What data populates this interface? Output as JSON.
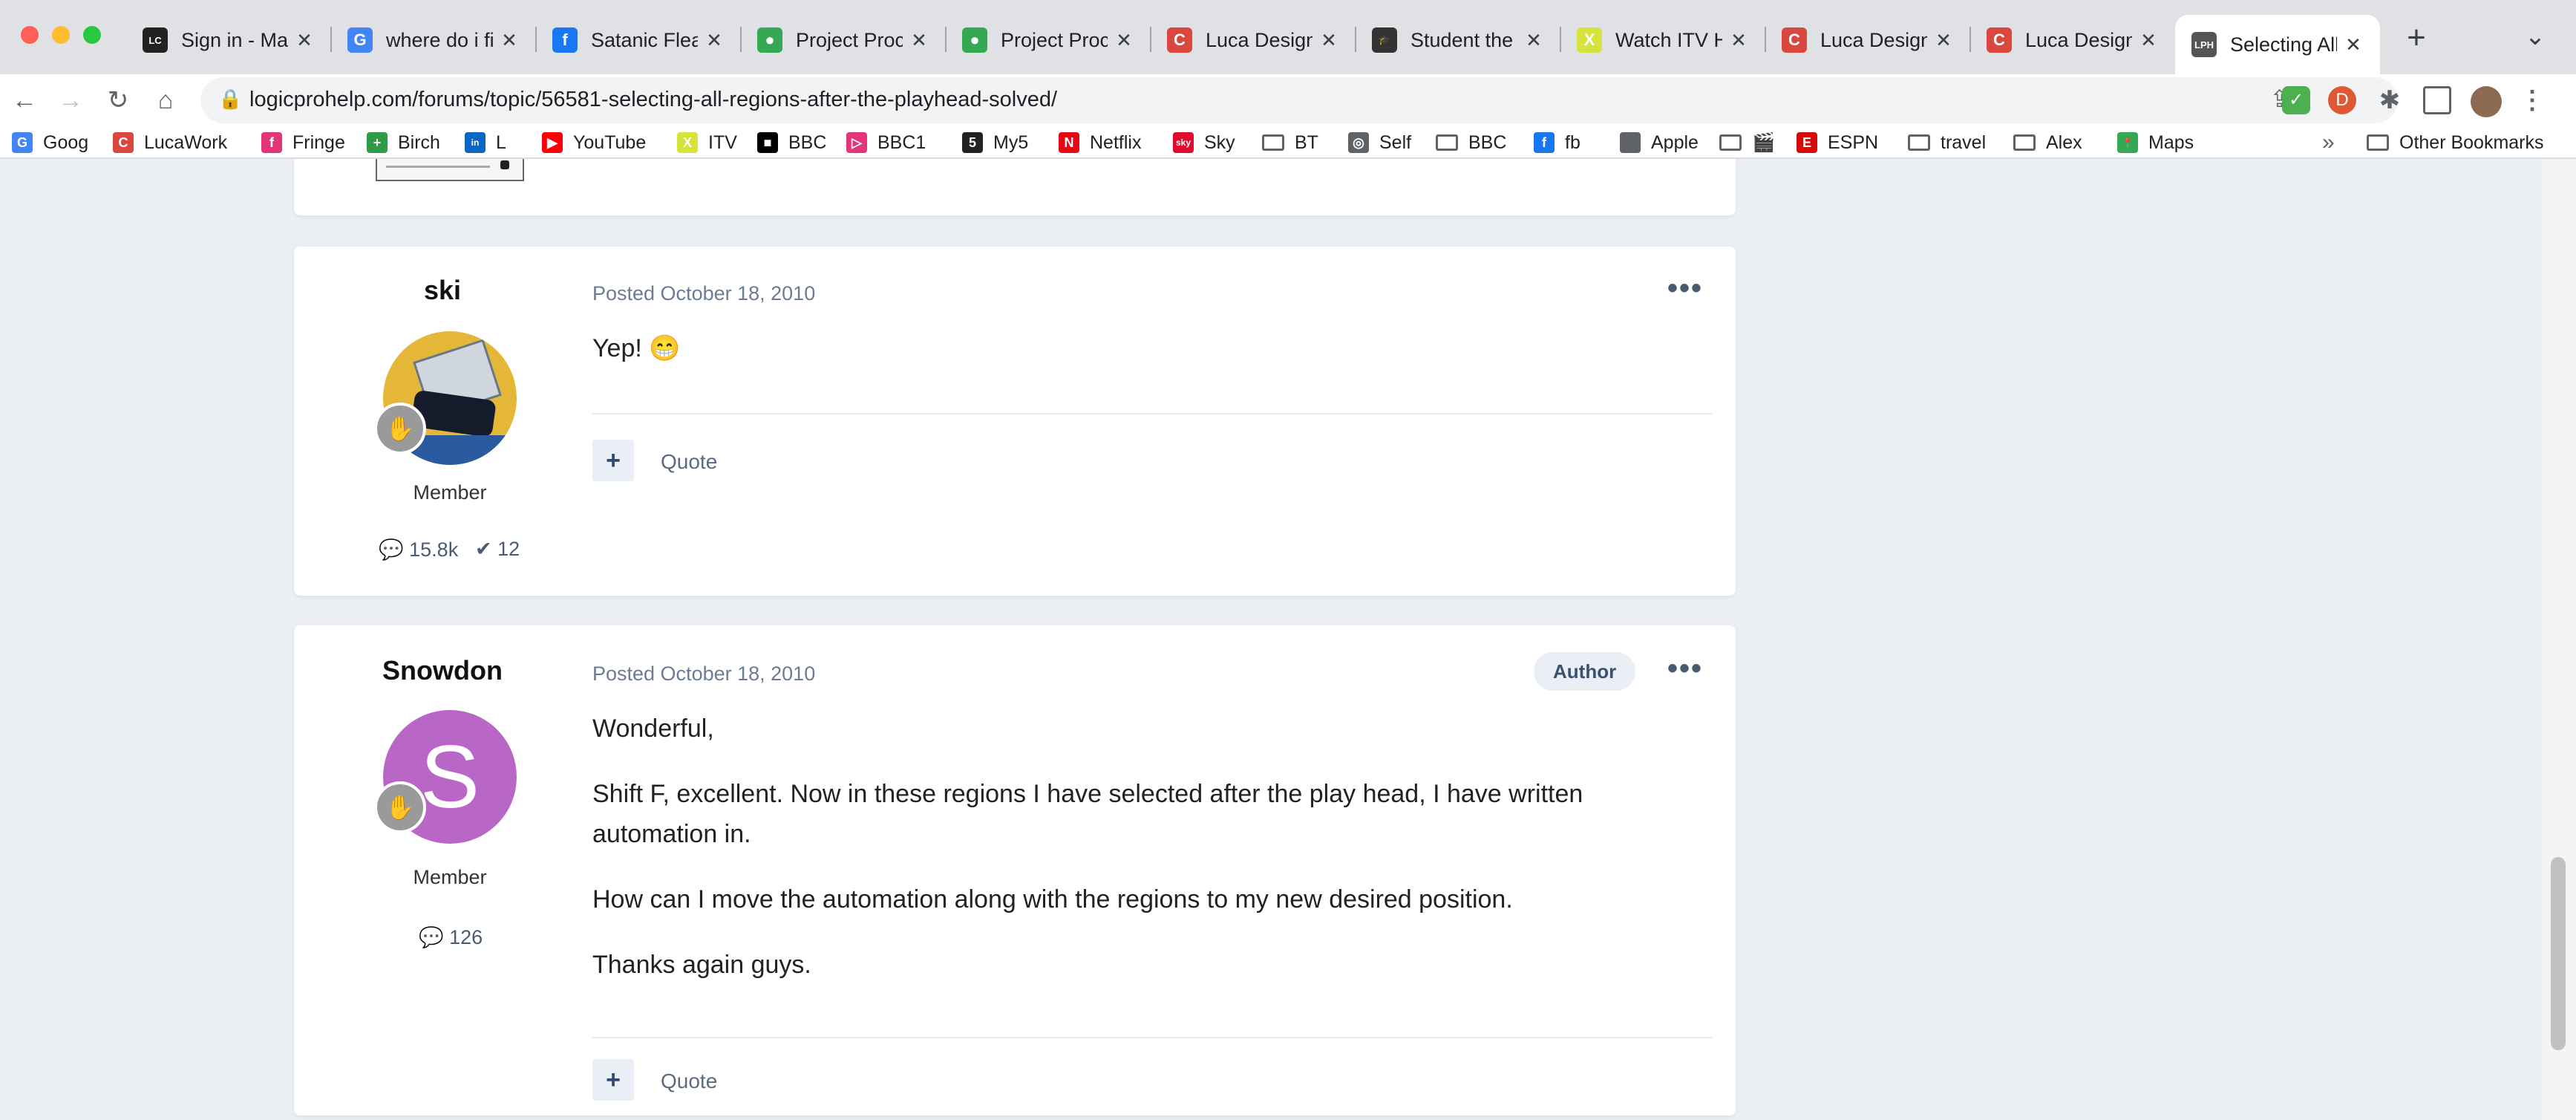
{
  "browser": {
    "tabs": [
      {
        "title": "Sign in - Mak",
        "fav": "LC",
        "favColor": "#222222"
      },
      {
        "title": "where do i fir",
        "fav": "G",
        "favColor": "#4285f4"
      },
      {
        "title": "Satanic Flea",
        "fav": "f",
        "favColor": "#1877f2"
      },
      {
        "title": "Project Proce",
        "fav": "●",
        "favColor": "#34a853"
      },
      {
        "title": "Project Proce",
        "fav": "●",
        "favColor": "#34a853"
      },
      {
        "title": "Luca Design",
        "fav": "C",
        "favColor": "#d9473f"
      },
      {
        "title": "Student the",
        "fav": "🎓",
        "favColor": "#333333"
      },
      {
        "title": "Watch ITV Hi",
        "fav": "X",
        "favColor": "#d7e23a"
      },
      {
        "title": "Luca Design",
        "fav": "C",
        "favColor": "#d9473f"
      },
      {
        "title": "Luca Design",
        "fav": "C",
        "favColor": "#d9473f"
      },
      {
        "title": "Selecting All",
        "fav": "LPH",
        "favColor": "#555555"
      }
    ],
    "new_tab": "+",
    "tab_menu": "⌄",
    "close": "✕",
    "url": "logicprohelp.com/forums/topic/56581-selecting-all-regions-after-the-playhead-solved/",
    "back": "←",
    "forward": "→",
    "reload": "↻",
    "home": "⌂"
  },
  "bookmarks": {
    "items": [
      {
        "label": "Goog",
        "icon": "G",
        "color": "#4285f4"
      },
      {
        "label": "LucaWork",
        "icon": "C",
        "color": "#d9473f"
      },
      {
        "label": "Fringe",
        "icon": "f",
        "color": "#e2357a"
      },
      {
        "label": "Birch",
        "icon": "+",
        "color": "#2e9b47"
      },
      {
        "label": "L",
        "icon": "in",
        "color": "#0a66c2"
      },
      {
        "label": "YouTube",
        "icon": "▶",
        "color": "#ff0000"
      },
      {
        "label": "ITV",
        "icon": "X",
        "color": "#d7e23a"
      },
      {
        "label": "BBC",
        "icon": "■",
        "color": "#000000"
      },
      {
        "label": "BBC1",
        "icon": "▷",
        "color": "#e2357a"
      },
      {
        "label": "My5",
        "icon": "5",
        "color": "#222222"
      },
      {
        "label": "Netflix",
        "icon": "N",
        "color": "#e50914"
      },
      {
        "label": "Sky",
        "icon": "sky",
        "color": "#e10a2c"
      },
      {
        "label": "BT",
        "icon": "folder",
        "color": ""
      },
      {
        "label": "Self",
        "icon": "◎",
        "color": "#5f6368"
      },
      {
        "label": "BBC",
        "icon": "folder",
        "color": ""
      },
      {
        "label": "fb",
        "icon": "f",
        "color": "#1877f2"
      },
      {
        "label": "Apple",
        "icon": "",
        "color": "#5f6368"
      },
      {
        "label": "🎬",
        "icon": "folder",
        "color": ""
      },
      {
        "label": "ESPN",
        "icon": "E",
        "color": "#d50a0a"
      },
      {
        "label": "travel",
        "icon": "folder",
        "color": ""
      },
      {
        "label": "Alex",
        "icon": "folder",
        "color": ""
      },
      {
        "label": "Maps",
        "icon": "📍",
        "color": "#34a853"
      }
    ],
    "overflow": "»",
    "other": "Other Bookmarks"
  },
  "posts": [
    {
      "author": "ski",
      "role": "Member",
      "posts_count": "15.8k",
      "solutions_count": "12",
      "date": "Posted October 18, 2010",
      "body": [
        "Yep! 😁"
      ],
      "quote": "Quote",
      "plus": "+",
      "more": "•••"
    },
    {
      "author": "Snowdon",
      "avatar_letter": "S",
      "role": "Member",
      "posts_count": "126",
      "date": "Posted October 18, 2010",
      "badge": "Author",
      "body": [
        "Wonderful,",
        "Shift F, excellent. Now in these regions I have selected after the play head, I have written automation in.",
        "How can I move the automation along with the regions to my new desired position.",
        "Thanks again guys."
      ],
      "quote": "Quote",
      "plus": "+",
      "more": "•••"
    }
  ],
  "colors": {
    "page_bg": "#ebeef2",
    "snowdon_avatar": "#b967c7",
    "accent": "#3c5170"
  }
}
